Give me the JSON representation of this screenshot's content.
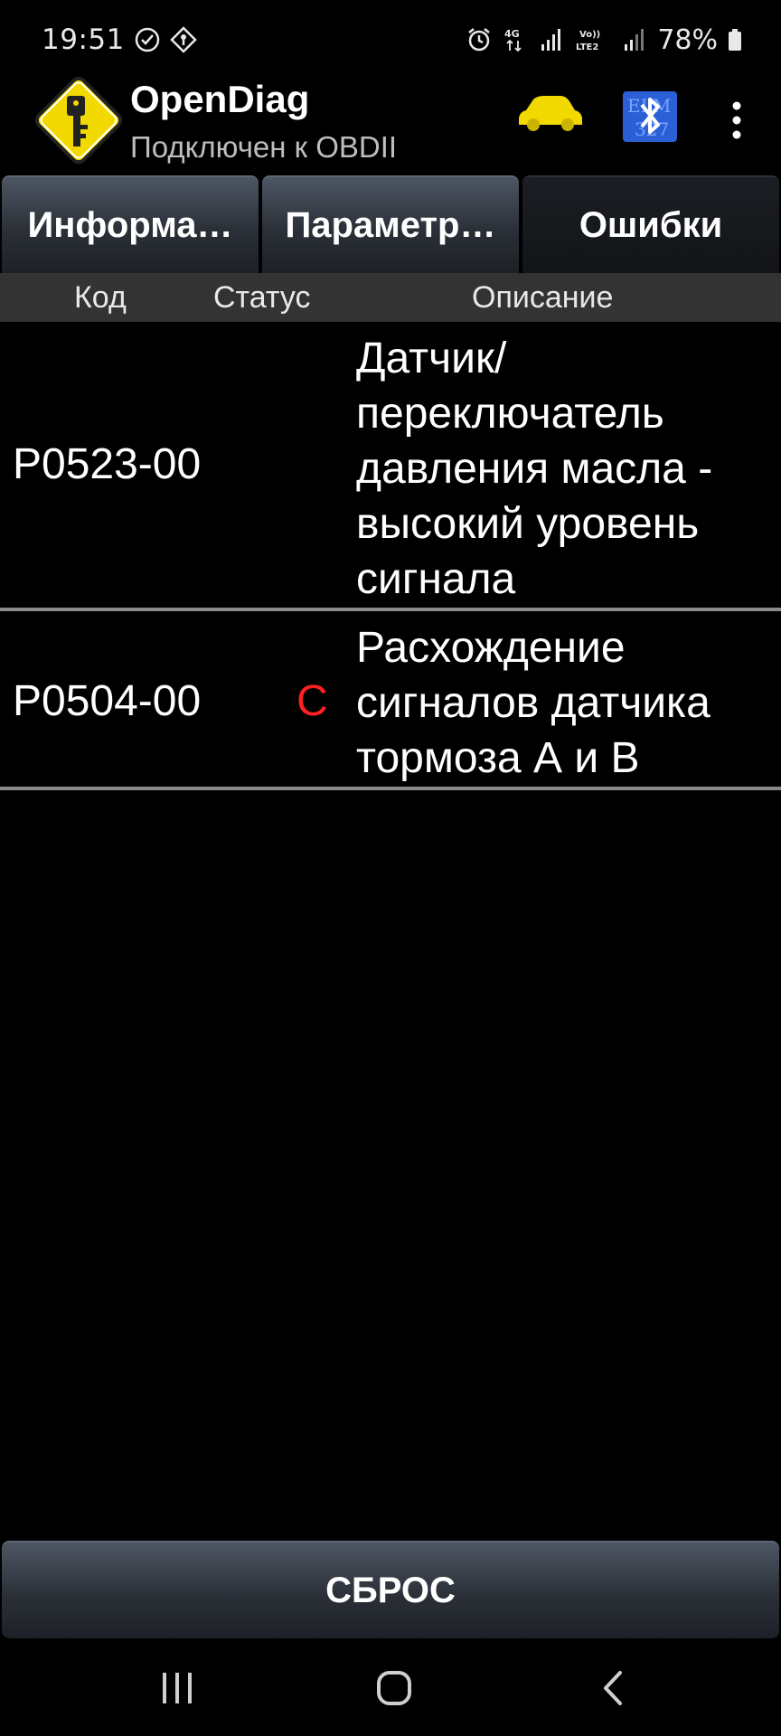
{
  "status_bar": {
    "time": "19:51",
    "battery": "78%",
    "icons": [
      "sync-check-icon",
      "location-diamond-icon",
      "alarm-icon",
      "4g-icon",
      "signal-icon",
      "volte-icon",
      "signal-icon-2",
      "battery-icon"
    ]
  },
  "app": {
    "title": "OpenDiag",
    "subtitle": "Подключен к OBDII"
  },
  "tabs": [
    {
      "label": "Информа…",
      "active": false
    },
    {
      "label": "Параметр…",
      "active": false
    },
    {
      "label": "Ошибки",
      "active": true
    }
  ],
  "columns": {
    "code": "Код",
    "status": "Статус",
    "description": "Описание"
  },
  "errors": [
    {
      "code": "P0523-00",
      "status": "",
      "description": "Датчик/ переключатель давления масла - высокий уровень сигнала"
    },
    {
      "code": "P0504-00",
      "status": "C",
      "description": "Расхождение сигналов датчика тормоза А и В"
    }
  ],
  "reset_button": "СБРОС",
  "colors": {
    "accent_yellow": "#f2d900",
    "bt_blue": "#2a5fd6",
    "status_red": "#ff2020"
  }
}
